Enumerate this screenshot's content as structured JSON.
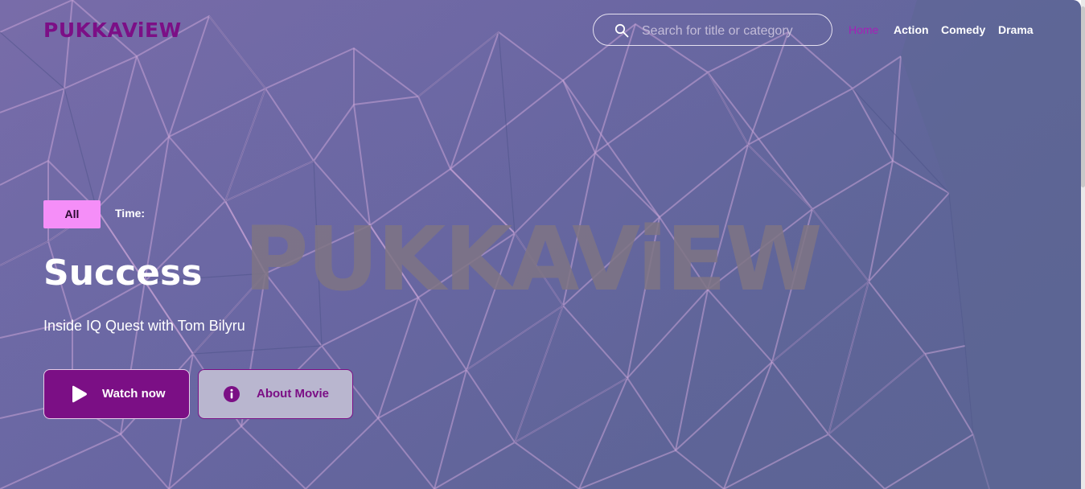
{
  "header": {
    "logo_text": "PUKKAViEW",
    "search": {
      "placeholder": "Search for title or category",
      "value": ""
    },
    "nav": [
      {
        "label": "Home",
        "active": true
      },
      {
        "label": "Action",
        "active": false
      },
      {
        "label": "Comedy",
        "active": false
      },
      {
        "label": "Drama",
        "active": false
      }
    ]
  },
  "hero": {
    "watermark_text": "PUKKAViEW",
    "filter": {
      "all_label": "All",
      "time_label": "Time:"
    },
    "title": "Success",
    "subtitle": "Inside IQ Quest with Tom Bilyru",
    "buttons": {
      "watch_label": "Watch now",
      "about_label": "About Movie"
    }
  },
  "colors": {
    "brand": "#7b0f85",
    "pill": "#f58ef8",
    "nav_active": "#a51fb8",
    "background": "#67649f"
  },
  "icons": {
    "search": "search-icon",
    "play": "play-icon",
    "info": "info-icon"
  }
}
